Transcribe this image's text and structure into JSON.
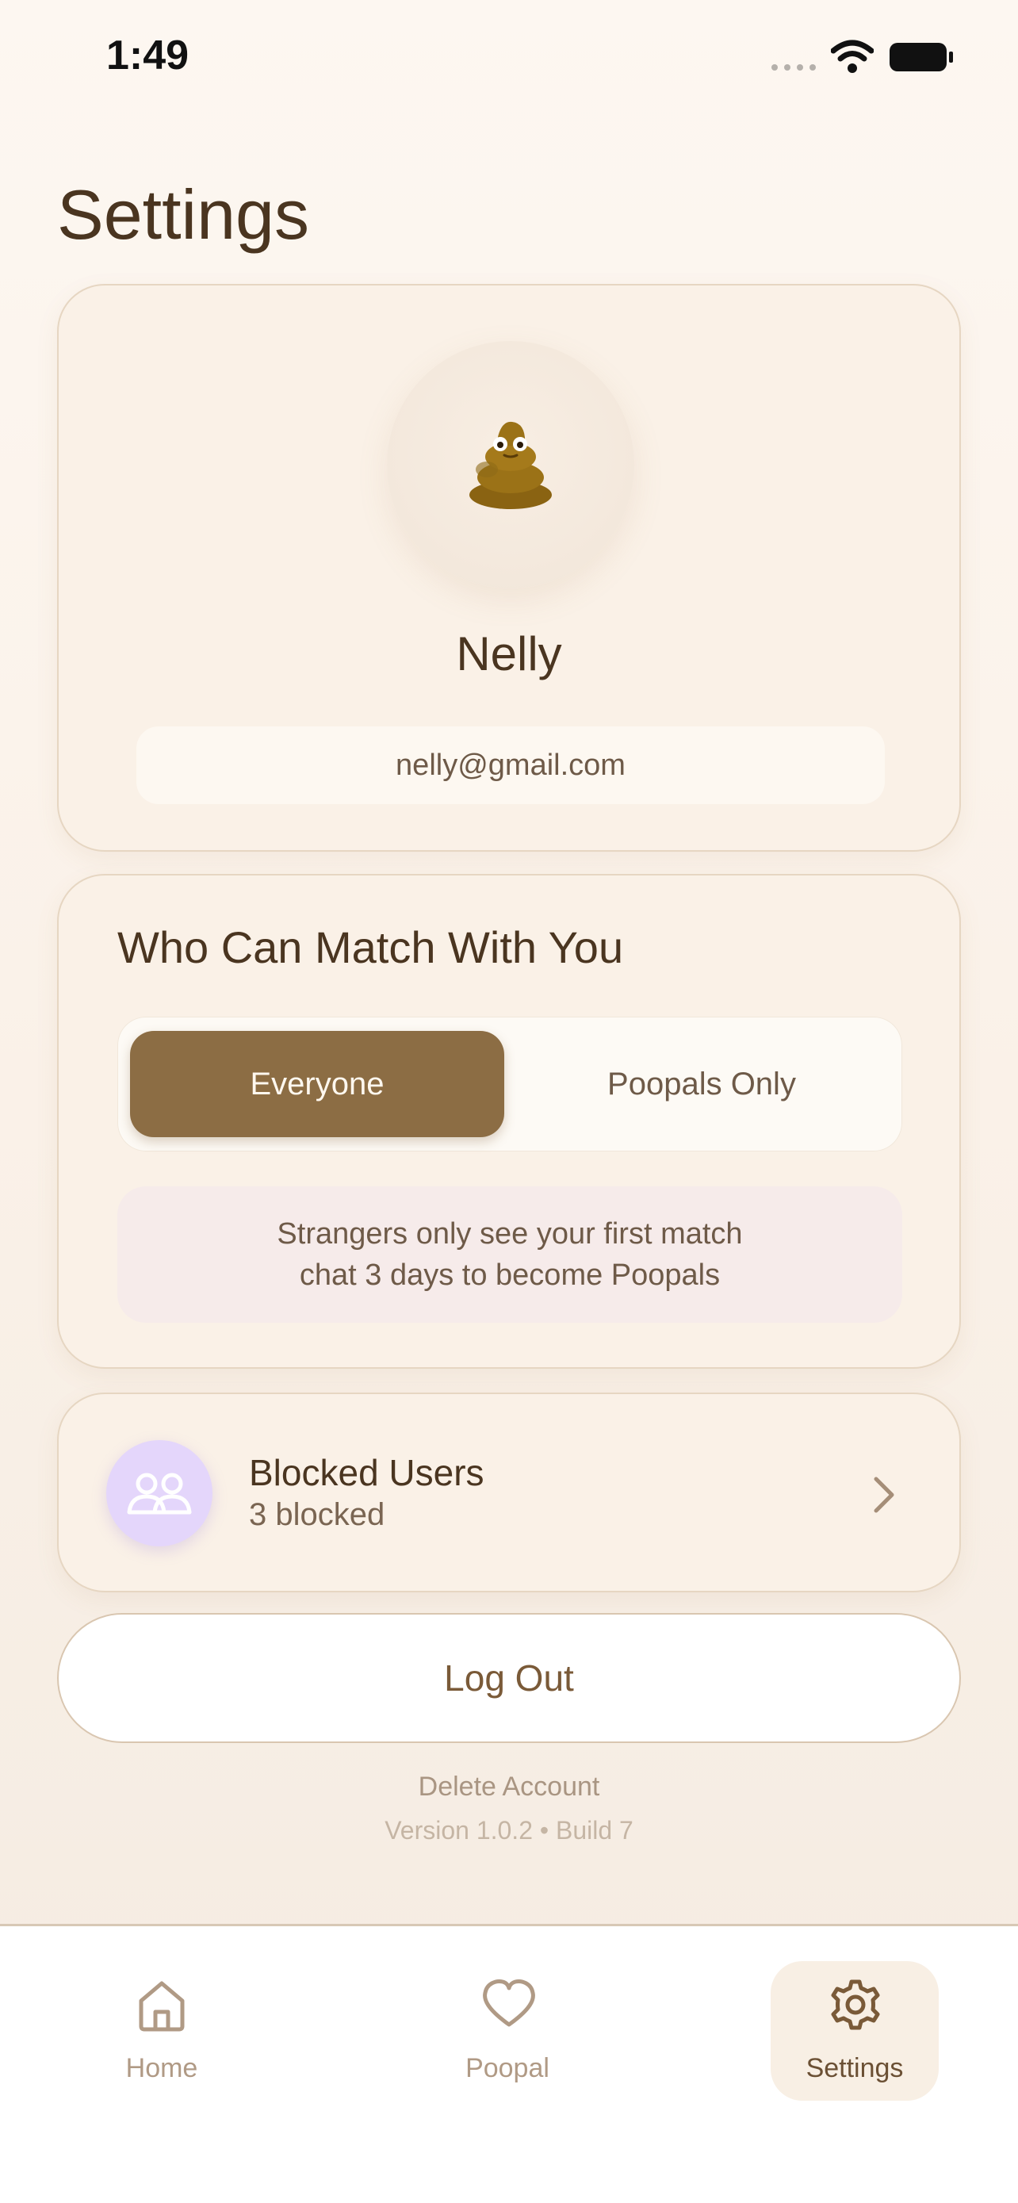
{
  "status_bar": {
    "time": "1:49"
  },
  "page": {
    "title": "Settings"
  },
  "profile": {
    "name": "Nelly",
    "email": "nelly@gmail.com",
    "avatar": "poop-emoji"
  },
  "match": {
    "title": "Who Can Match With You",
    "options": [
      "Everyone",
      "Poopals Only"
    ],
    "selected": "Everyone",
    "info_line1": "Strangers only see your first match",
    "info_line2": "chat 3 days to become Poopals"
  },
  "blocked": {
    "title": "Blocked Users",
    "count_label": "3 blocked",
    "icon": "users-icon"
  },
  "actions": {
    "logout_label": "Log Out",
    "delete_label": "Delete Account"
  },
  "footer": {
    "version": "Version 1.0.2 • Build 7"
  },
  "tabs": [
    {
      "label": "Home",
      "icon": "home-icon"
    },
    {
      "label": "Poopal",
      "icon": "heart-icon"
    },
    {
      "label": "Settings",
      "icon": "gear-icon",
      "active": true
    }
  ],
  "colors": {
    "accent": "#8c6d44",
    "text_primary": "#4a3520",
    "card_bg": "#faf1e7",
    "info_bg": "#f6ebea",
    "blocked_icon_bg": "#e4d6fb"
  }
}
